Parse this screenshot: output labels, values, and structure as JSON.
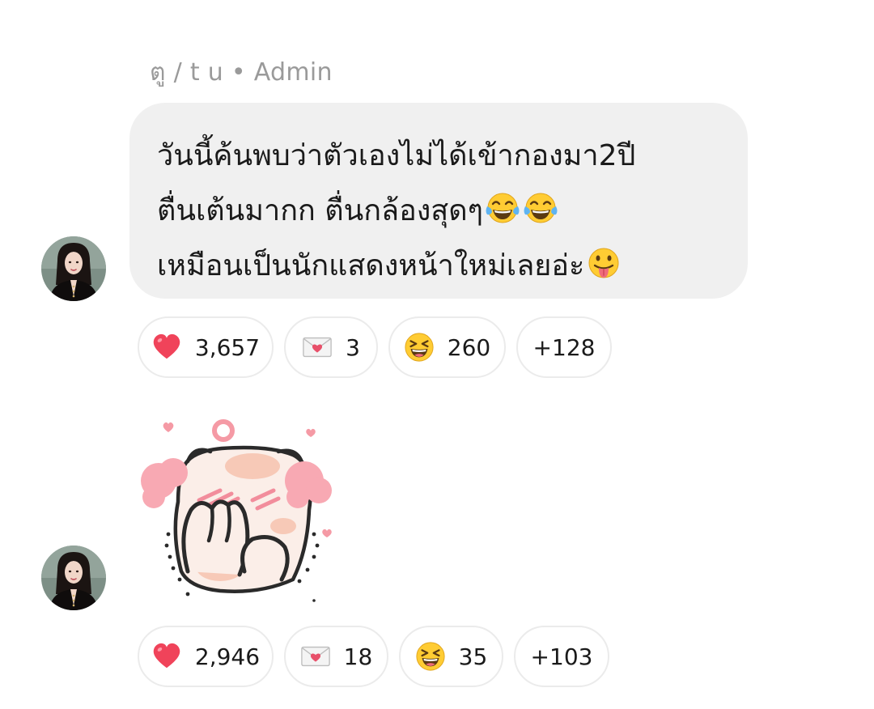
{
  "messages": [
    {
      "sender": "ตู / t u",
      "role": "Admin",
      "text_lines": [
        "วันนี้ค้นพบว่าตัวเองไม่ได้เข้ากองมา2ปี",
        "ตื่นเต้นมากก ตื่นกล้องสุดๆ",
        "เหมือนเป็นนักแสดงหน้าใหม่เลยอ่ะ"
      ],
      "inline_emojis": [
        "face-with-tears-of-joy",
        "face-with-tears-of-joy",
        "face-with-tongue"
      ],
      "reactions": [
        {
          "icon": "heart-icon",
          "count": "3,657"
        },
        {
          "icon": "love-letter-icon",
          "count": "3"
        },
        {
          "icon": "grinning-squinting-face-icon",
          "count": "260"
        },
        {
          "icon": "more-reactions",
          "count": "+128"
        }
      ]
    },
    {
      "sticker": "blushing-cat-sticker",
      "reactions": [
        {
          "icon": "heart-icon",
          "count": "2,946"
        },
        {
          "icon": "love-letter-icon",
          "count": "18"
        },
        {
          "icon": "grinning-squinting-face-icon",
          "count": "35"
        },
        {
          "icon": "more-reactions",
          "count": "+103"
        }
      ]
    }
  ],
  "separator": "•",
  "colors": {
    "bubble_bg": "#f0f0f0",
    "meta_text": "#9a9a9a",
    "pill_border": "#ebebeb",
    "heart": "#f0435a",
    "emoji_yellow": "#ffcc33"
  }
}
